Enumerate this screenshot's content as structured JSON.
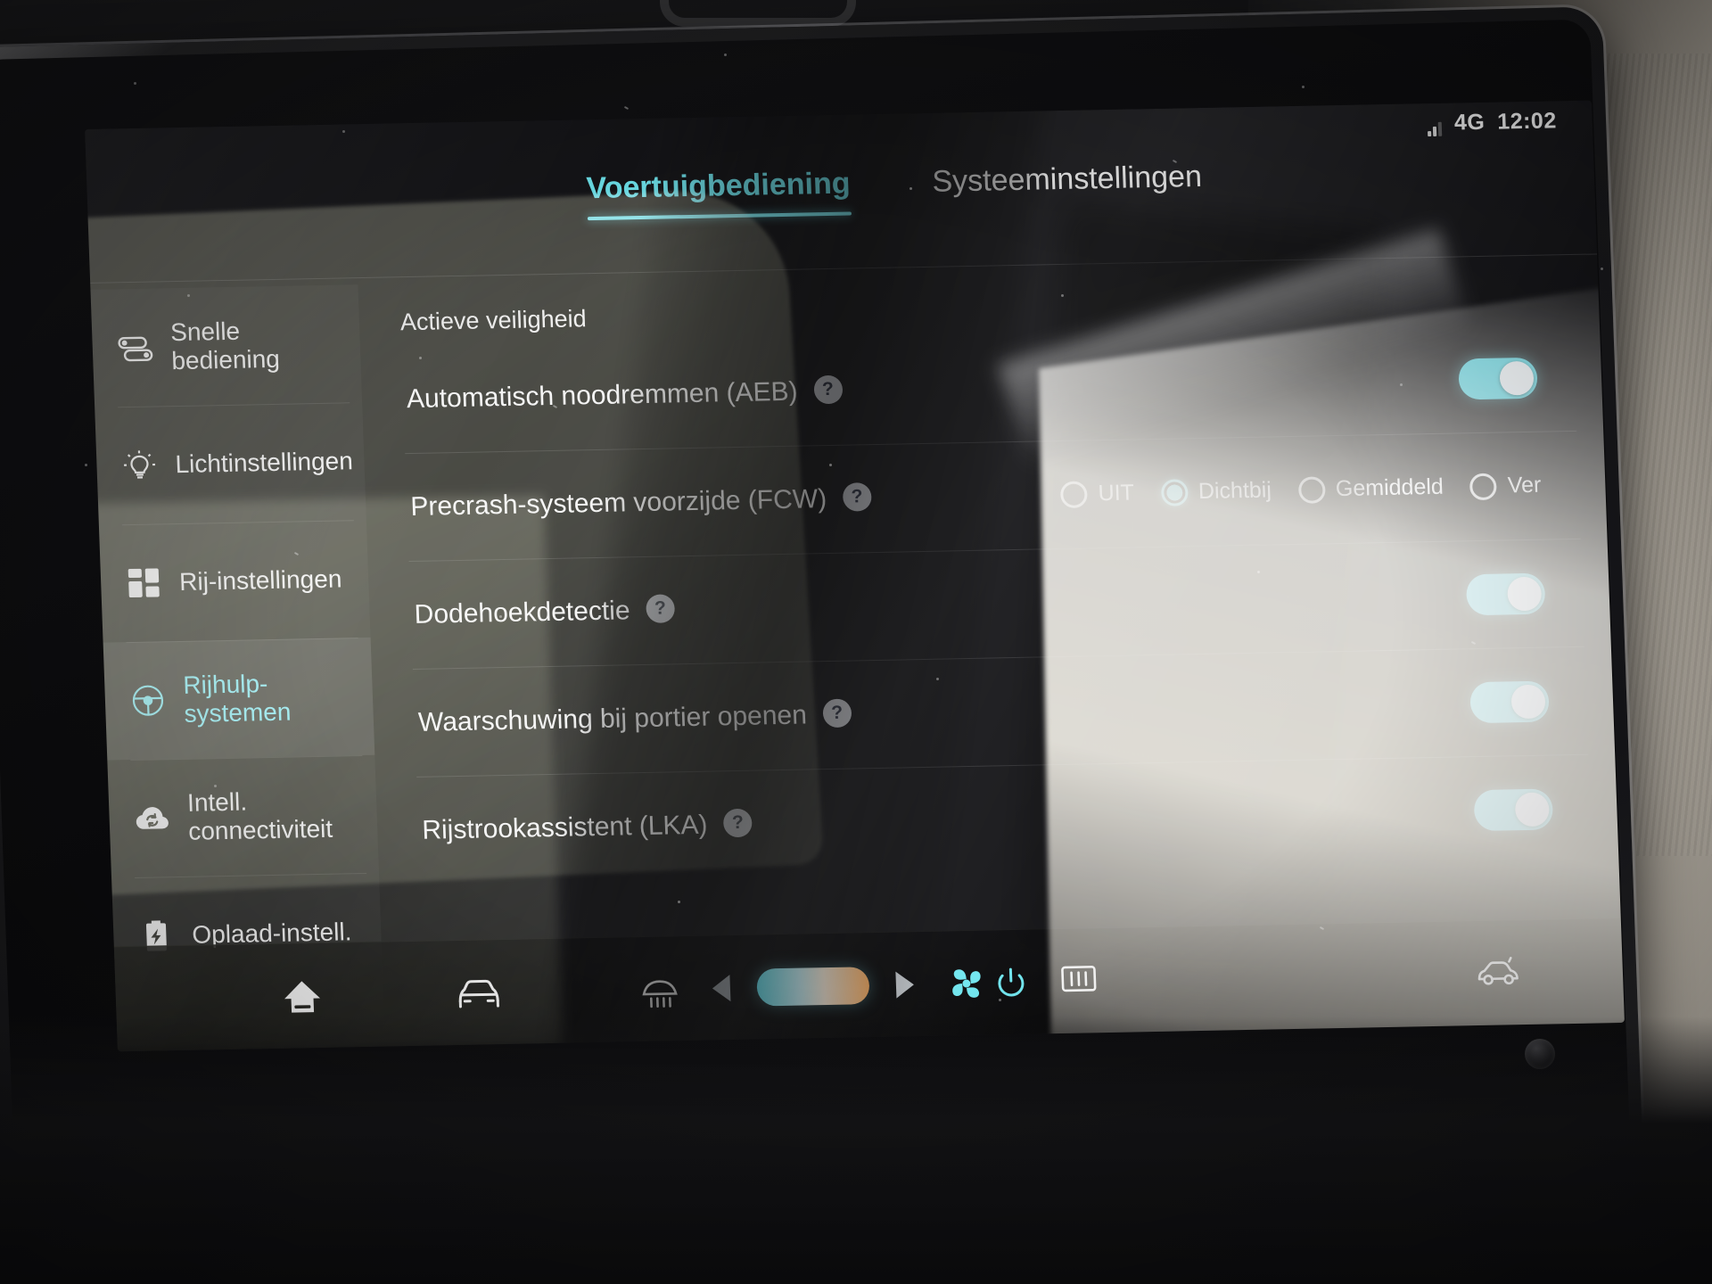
{
  "status": {
    "network": "4G",
    "time": "12:02",
    "signal_icon": "signal-bars-icon"
  },
  "tabs": [
    {
      "label": "Voertuigbediening",
      "active": true
    },
    {
      "label": "Systeeminstellingen",
      "active": false
    }
  ],
  "sidebar": {
    "items": [
      {
        "label": "Snelle bediening",
        "icon": "sliders-icon",
        "active": false
      },
      {
        "label": "Lichtinstellingen",
        "icon": "lightbulb-icon",
        "active": false
      },
      {
        "label": "Rij-instellingen",
        "icon": "grid-icon",
        "active": false
      },
      {
        "label": "Rijhulp-systemen",
        "icon": "steering-wheel-icon",
        "active": true
      },
      {
        "label": "Intell. connectiviteit",
        "icon": "cloud-sync-icon",
        "active": false
      },
      {
        "label": "Oplaad-instell.",
        "icon": "battery-charge-icon",
        "active": false
      }
    ]
  },
  "content": {
    "section_title": "Actieve veiligheid",
    "help_glyph": "?",
    "rows": [
      {
        "label": "Automatisch noodremmen (AEB)",
        "control": "toggle",
        "toggle_on": true
      },
      {
        "label": "Precrash-systeem voorzijde (FCW)",
        "control": "radio",
        "options": [
          {
            "label": "UIT",
            "selected": false
          },
          {
            "label": "Dichtbij",
            "selected": true
          },
          {
            "label": "Gemiddeld",
            "selected": false
          },
          {
            "label": "Ver",
            "selected": false
          }
        ]
      },
      {
        "label": "Dodehoekdetectie",
        "control": "toggle",
        "toggle_on": true
      },
      {
        "label": "Waarschuwing bij portier openen",
        "control": "toggle",
        "toggle_on": true
      },
      {
        "label": "Rijstrookassistent (LKA)",
        "control": "toggle",
        "toggle_on": true
      }
    ]
  },
  "bottombar": {
    "left_icons": [
      {
        "name": "home-icon"
      },
      {
        "name": "car-front-icon"
      }
    ],
    "climate": {
      "front_defrost_icon": "front-defrost-icon",
      "decrease_icon": "arrow-left-icon",
      "temperature_slider": "temperature-slider",
      "increase_icon": "arrow-right-icon",
      "fan_icon": "fan-icon",
      "power_icon": "power-icon",
      "rear_defrost_icon": "rear-defrost-icon"
    },
    "right_icons": [
      {
        "name": "car-side-icon"
      }
    ]
  },
  "colors": {
    "accent": "#7debf3",
    "toggle_on": "#5fd8e4",
    "text": "#f2f2f2",
    "panel": "#141417"
  }
}
